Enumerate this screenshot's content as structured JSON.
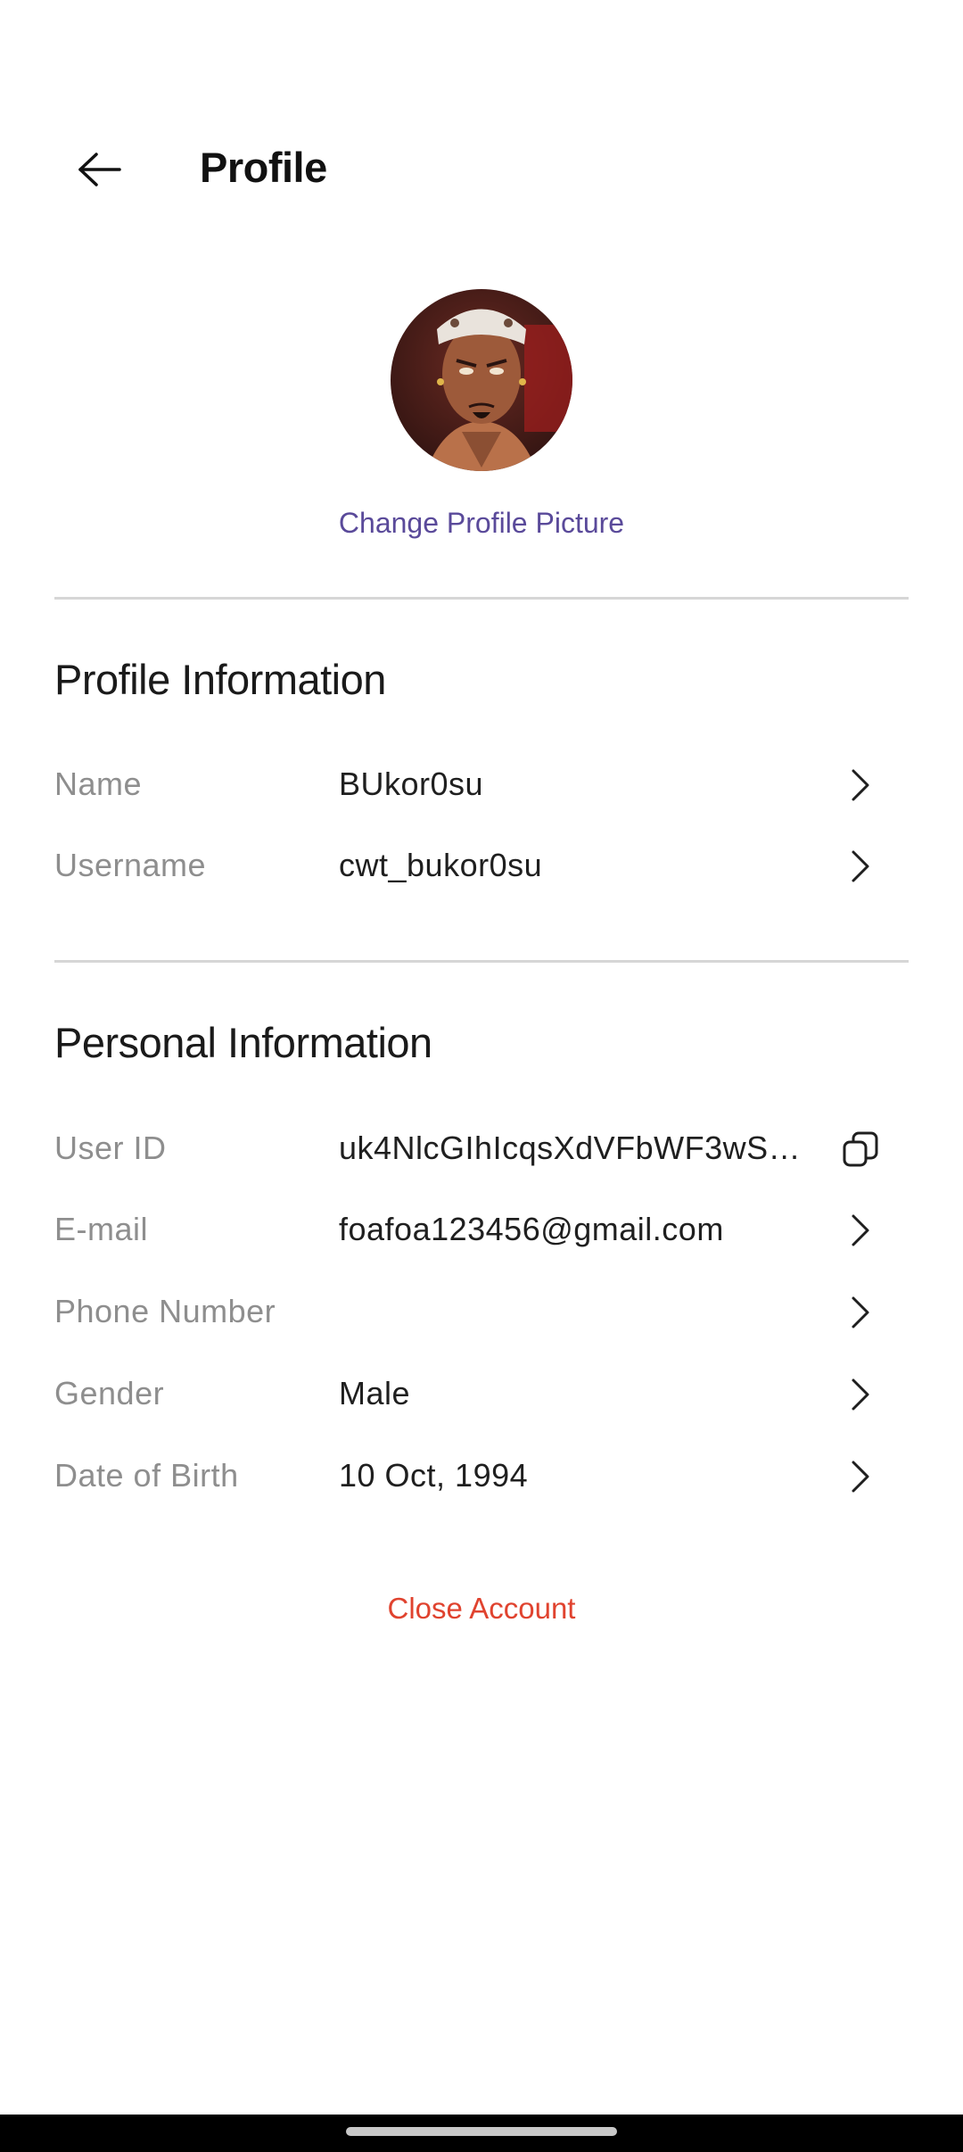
{
  "header": {
    "title": "Profile",
    "back_icon": "arrow-left-icon"
  },
  "avatar": {
    "alt": "Profile picture",
    "change_label": "Change Profile Picture"
  },
  "profile_info": {
    "title": "Profile Information",
    "rows": [
      {
        "label": "Name",
        "value": "BUkor0su",
        "action_icon": "chevron-right-icon"
      },
      {
        "label": "Username",
        "value": "cwt_bukor0su",
        "action_icon": "chevron-right-icon"
      }
    ]
  },
  "personal_info": {
    "title": "Personal Information",
    "rows": [
      {
        "label": "User ID",
        "value": "uk4NlcGIhIcqsXdVFbWF3wS…",
        "action_icon": "copy-icon"
      },
      {
        "label": "E-mail",
        "value": "foafoa123456@gmail.com",
        "action_icon": "chevron-right-icon"
      },
      {
        "label": "Phone Number",
        "value": "",
        "action_icon": "chevron-right-icon"
      },
      {
        "label": "Gender",
        "value": "Male",
        "action_icon": "chevron-right-icon"
      },
      {
        "label": "Date of Birth",
        "value": "10 Oct, 1994",
        "action_icon": "chevron-right-icon"
      }
    ]
  },
  "close_account": {
    "label": "Close Account",
    "color": "#e0432f"
  },
  "colors": {
    "accent": "#5a4a9a",
    "label_gray": "#8e8e8e",
    "divider": "#d6d6d6",
    "danger": "#e0432f"
  }
}
